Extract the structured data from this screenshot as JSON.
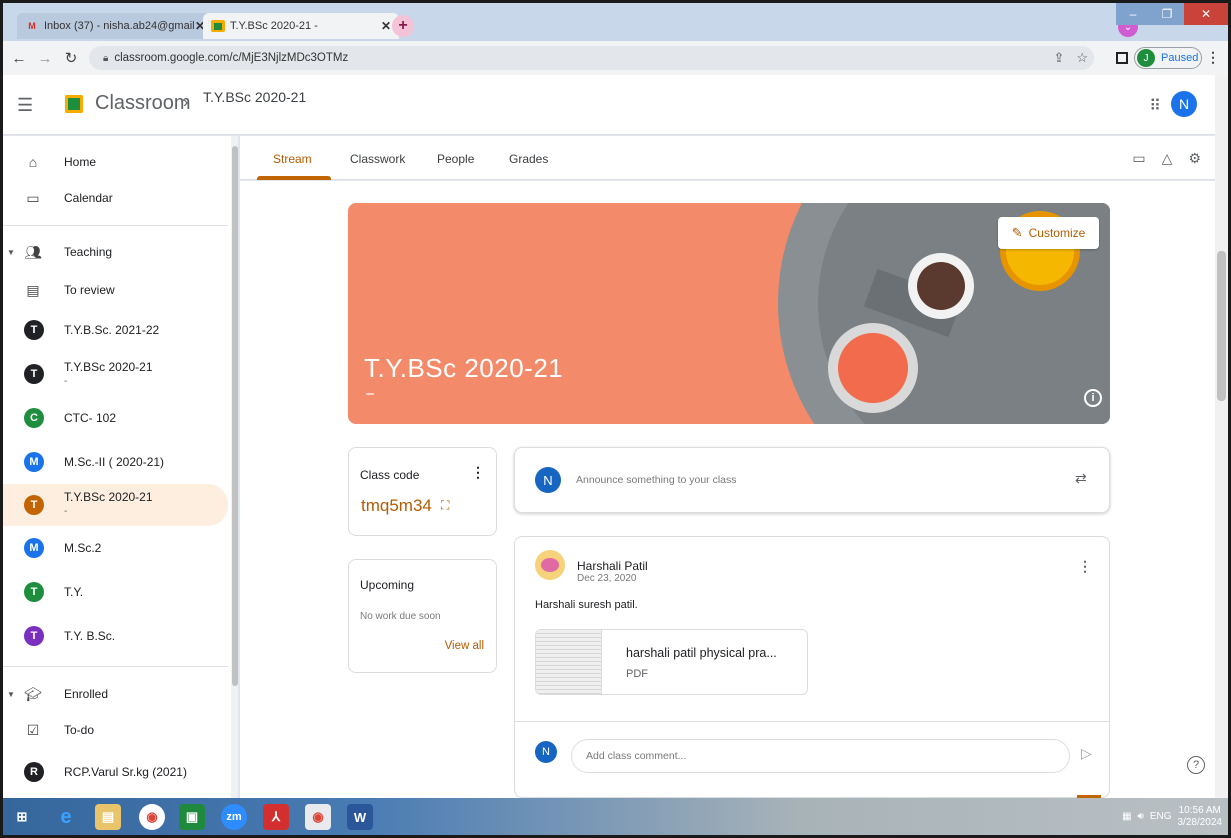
{
  "browser": {
    "tabs": [
      {
        "title": "Inbox (37) - nisha.ab24@gmail.c",
        "favicon": "gmail-icon",
        "active": false
      },
      {
        "title": "T.Y.BSc 2020-21 -",
        "favicon": "classroom-icon",
        "active": true
      }
    ],
    "url": "classroom.google.com/c/MjE3NjlzMDc3OTMz",
    "profile_status": "Paused",
    "profile_initial": "J"
  },
  "app": {
    "name": "Classroom",
    "class_name": "T.Y.BSc 2020-21",
    "user_initial": "N"
  },
  "sidebar": {
    "home": "Home",
    "calendar": "Calendar",
    "teaching": "Teaching",
    "to_review": "To review",
    "classes": [
      {
        "initial": "T",
        "label": "T.Y.B.Sc. 2021-22",
        "color": "#202124"
      },
      {
        "initial": "T",
        "label": "T.Y.BSc 2020-21",
        "color": "#202124",
        "sub": "-"
      },
      {
        "initial": "C",
        "label": "CTC- 102",
        "color": "#1e8e3e"
      },
      {
        "initial": "M",
        "label": "M.Sc.-II ( 2020-21)",
        "color": "#1a73e8"
      },
      {
        "initial": "T",
        "label": "T.Y.BSc 2020-21",
        "color": "#c26401",
        "sub": "-",
        "selected": true
      },
      {
        "initial": "M",
        "label": "M.Sc.2",
        "color": "#1a73e8"
      },
      {
        "initial": "T",
        "label": "T.Y.",
        "color": "#1e8e3e"
      },
      {
        "initial": "T",
        "label": "T.Y. B.Sc.",
        "color": "#7b2fbf"
      }
    ],
    "enrolled": "Enrolled",
    "todo": "To-do",
    "enrolled_classes": [
      {
        "initial": "R",
        "label": "RCP.Varul Sr.kg (2021)",
        "color": "#202124"
      }
    ]
  },
  "tabs": {
    "stream": "Stream",
    "classwork": "Classwork",
    "people": "People",
    "grades": "Grades"
  },
  "banner": {
    "title": "T.Y.BSc 2020-21",
    "subtitle": "-",
    "customize": "Customize"
  },
  "class_code": {
    "heading": "Class code",
    "code": "tmq5m34"
  },
  "upcoming": {
    "heading": "Upcoming",
    "empty": "No work due soon",
    "view_all": "View all"
  },
  "announce": {
    "placeholder": "Announce something to your class",
    "avatar_initial": "N"
  },
  "post": {
    "author": "Harshali Patil",
    "date": "Dec 23, 2020",
    "text": "Harshali suresh patil.",
    "attachment_name": "harshali patil physical pra...",
    "attachment_type": "PDF",
    "comment_placeholder": "Add class comment...",
    "comment_avatar": "N"
  },
  "taskbar": {
    "lang": "ENG",
    "time": "10:56 AM",
    "date": "3/28/2024"
  }
}
